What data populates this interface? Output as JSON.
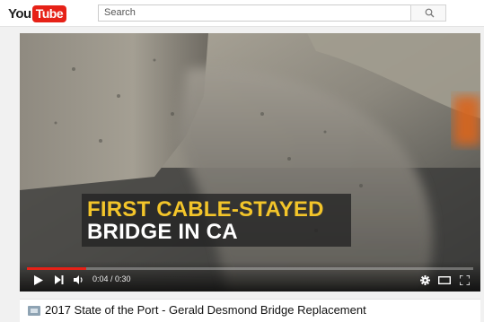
{
  "header": {
    "logo": {
      "you": "You",
      "tube": "Tube"
    },
    "search": {
      "placeholder": "Search"
    }
  },
  "player": {
    "caption": {
      "line1": "FIRST CABLE-STAYED",
      "line2": "BRIDGE IN CA"
    },
    "time": "0:04 / 0:30",
    "progress": 0.133,
    "icons": [
      "play-icon",
      "next-icon",
      "volume-icon",
      "settings-icon",
      "theater-mode-icon",
      "fullscreen-icon"
    ]
  },
  "video": {
    "title": "2017 State of the Port - Gerald Desmond Bridge Replacement"
  },
  "colors": {
    "brand_red": "#e62117",
    "caption_yellow": "#f3c52a",
    "caption_white": "#ffffff"
  }
}
